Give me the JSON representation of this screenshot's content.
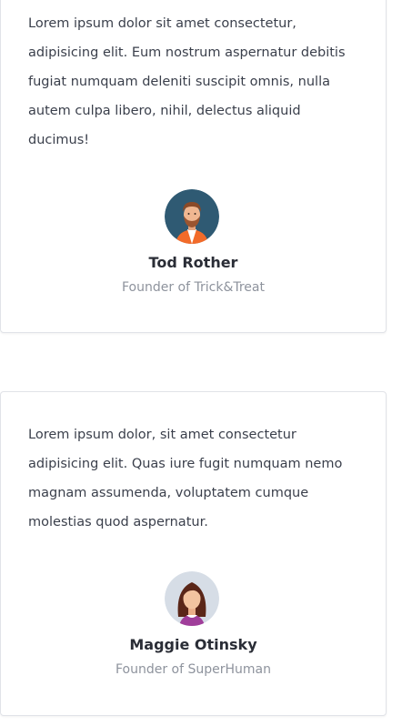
{
  "testimonials": [
    {
      "quote": "Lorem ipsum dolor sit amet consectetur, adipisicing elit. Eum nostrum aspernatur debitis fugiat numquam deleniti suscipit omnis, nulla autem culpa libero, nihil, delectus aliquid ducimus!",
      "name": "Tod Rother",
      "role": "Founder of Trick&Treat",
      "avatar_icon": "male-avatar-icon",
      "avatar_bg": "#2f5a73"
    },
    {
      "quote": "Lorem ipsum dolor, sit amet consectetur adipisicing elit. Quas iure fugit numquam nemo magnam assumenda, voluptatem cumque molestias quod aspernatur.",
      "name": "Maggie Otinsky",
      "role": "Founder of SuperHuman",
      "avatar_icon": "female-avatar-icon",
      "avatar_bg": "#d6dde6"
    }
  ]
}
